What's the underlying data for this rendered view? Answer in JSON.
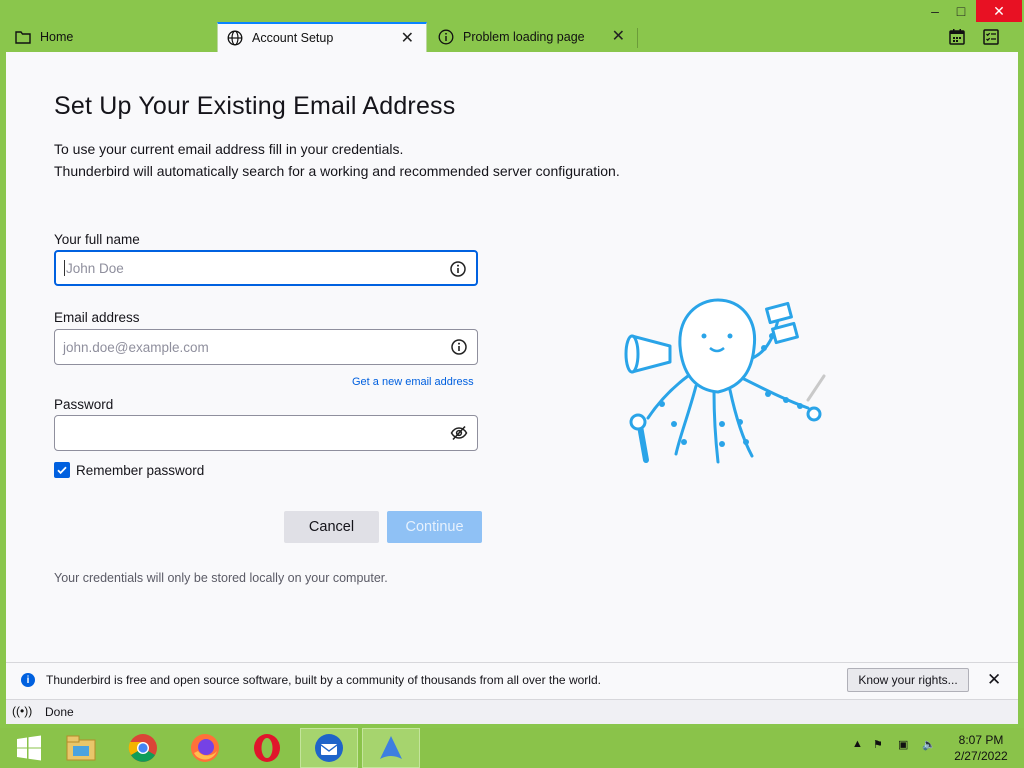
{
  "tabs": [
    {
      "label": "Home",
      "icon": "folder-icon"
    },
    {
      "label": "Account Setup",
      "icon": "globe-icon",
      "active": true
    },
    {
      "label": "Problem loading page",
      "icon": "info-icon"
    }
  ],
  "window_controls": {
    "minimize": "–",
    "maximize": "□",
    "close": "✕"
  },
  "page": {
    "title": "Set Up Your Existing Email Address",
    "description_line1": "To use your current email address fill in your credentials.",
    "description_line2": "Thunderbird will automatically search for a working and recommended server configuration.",
    "fullname": {
      "label": "Your full name",
      "placeholder": "John Doe",
      "value": ""
    },
    "email": {
      "label": "Email address",
      "placeholder": "john.doe@example.com",
      "value": ""
    },
    "get_new_email_link": "Get a new email address",
    "password": {
      "label": "Password",
      "value": ""
    },
    "remember_password": {
      "label": "Remember password",
      "checked": true
    },
    "cancel_label": "Cancel",
    "continue_label": "Continue",
    "local_note": "Your credentials will only be stored locally on your computer."
  },
  "notice": {
    "text": "Thunderbird is free and open source software, built by a community of thousands from all over the world.",
    "button": "Know your rights...",
    "close": "✕"
  },
  "status": {
    "text": "Done"
  },
  "taskbar": {
    "apps": [
      "file-explorer-icon",
      "chrome-icon",
      "firefox-icon",
      "opera-icon",
      "thunderbird-icon",
      "app-icon"
    ],
    "time": "8:07 PM",
    "date": "2/27/2022"
  },
  "colors": {
    "accent": "#0060df",
    "chrome_green": "#8ac64c",
    "continue_disabled": "#8fc1f5"
  }
}
